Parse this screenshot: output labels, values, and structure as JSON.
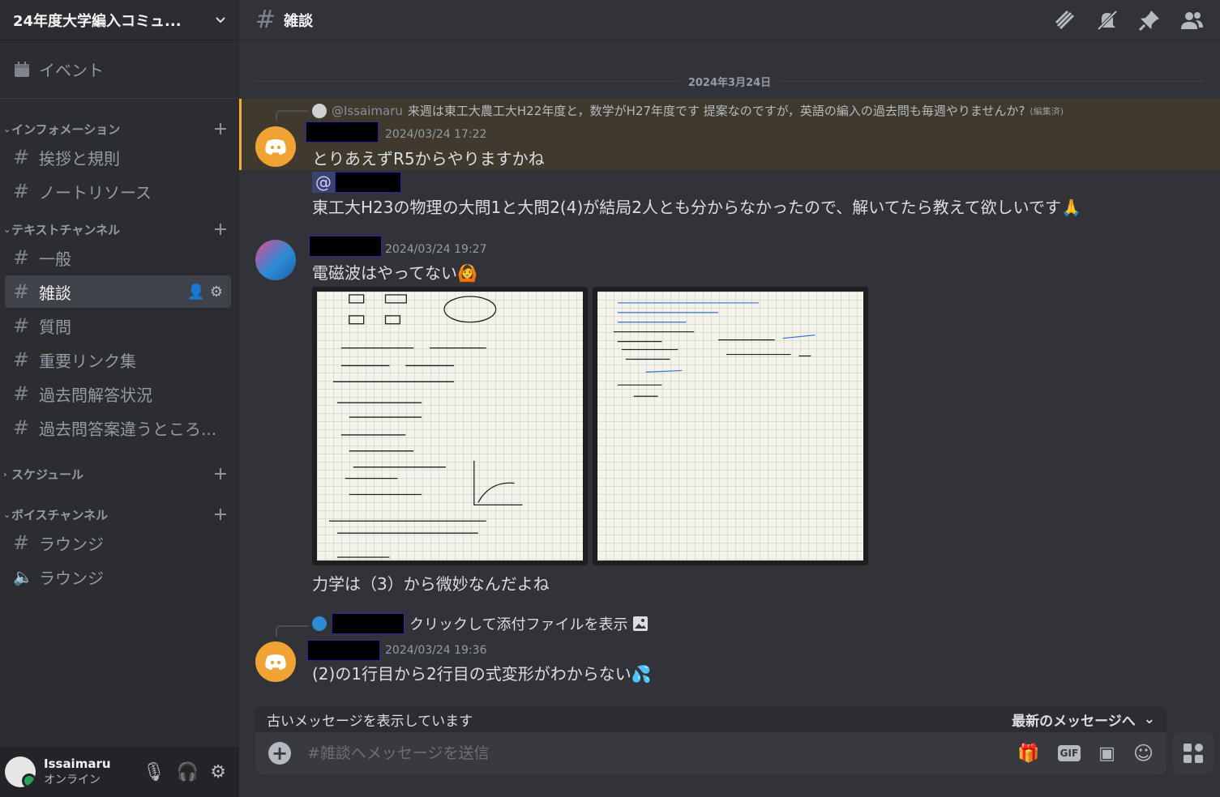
{
  "server": {
    "name": "24年度大学編入コミュ..."
  },
  "sidebar": {
    "events_label": "イベント",
    "categories": [
      {
        "label": "インフォメーション",
        "channels": [
          "挨拶と規則",
          "ノートリソース"
        ]
      },
      {
        "label": "テキストチャンネル",
        "channels": [
          "一般",
          "雑談",
          "質問",
          "重要リンク集",
          "過去問解答状況",
          "過去問答案違うところ..."
        ]
      },
      {
        "label": "スケジュール",
        "channels": []
      },
      {
        "label": "ボイスチャンネル",
        "channels": [
          "ラウンジ",
          "ラウンジ"
        ]
      }
    ],
    "active_channel": "雑談"
  },
  "user": {
    "name": "Issaimaru",
    "status": "オンライン",
    "status_color": "#23a55a"
  },
  "channel": {
    "title": "雑談"
  },
  "date_divider": "2024年3月24日",
  "messages": [
    {
      "reply": {
        "mention": "@Issaimaru",
        "text": "来週は東工大農工大H22年度と，数学がH27年度です 提案なのですが，英語の編入の過去問も毎週やりませんか?",
        "edited": "(編集済)"
      },
      "time": "2024/03/24 17:22",
      "lines": [
        "とりあえずR5からやりますかね"
      ],
      "highlight_color": "#f0b132"
    },
    {
      "mention_at": "@",
      "lines": [
        "東工大H23の物理の大問1と大問2(4)が結局2人とも分からなかったので、解いてたら教えて欲しいです🙏"
      ]
    },
    {
      "time": "2024/03/24 19:27",
      "lines": [
        "電磁波はやってない🙆"
      ],
      "after_images": "力学は（3）から微妙なんだよね"
    },
    {
      "reply": {
        "text": "クリックして添付ファイルを表示"
      },
      "time": "2024/03/24 19:36",
      "lines": [
        "(2)の1行目から2行目の式変形がわからない💦"
      ]
    }
  ],
  "banner": {
    "old_text": "古いメッセージを表示しています",
    "jump_label": "最新のメッセージへ"
  },
  "composer": {
    "placeholder": "#雑談へメッセージを送信",
    "gif_label": "GIF"
  }
}
